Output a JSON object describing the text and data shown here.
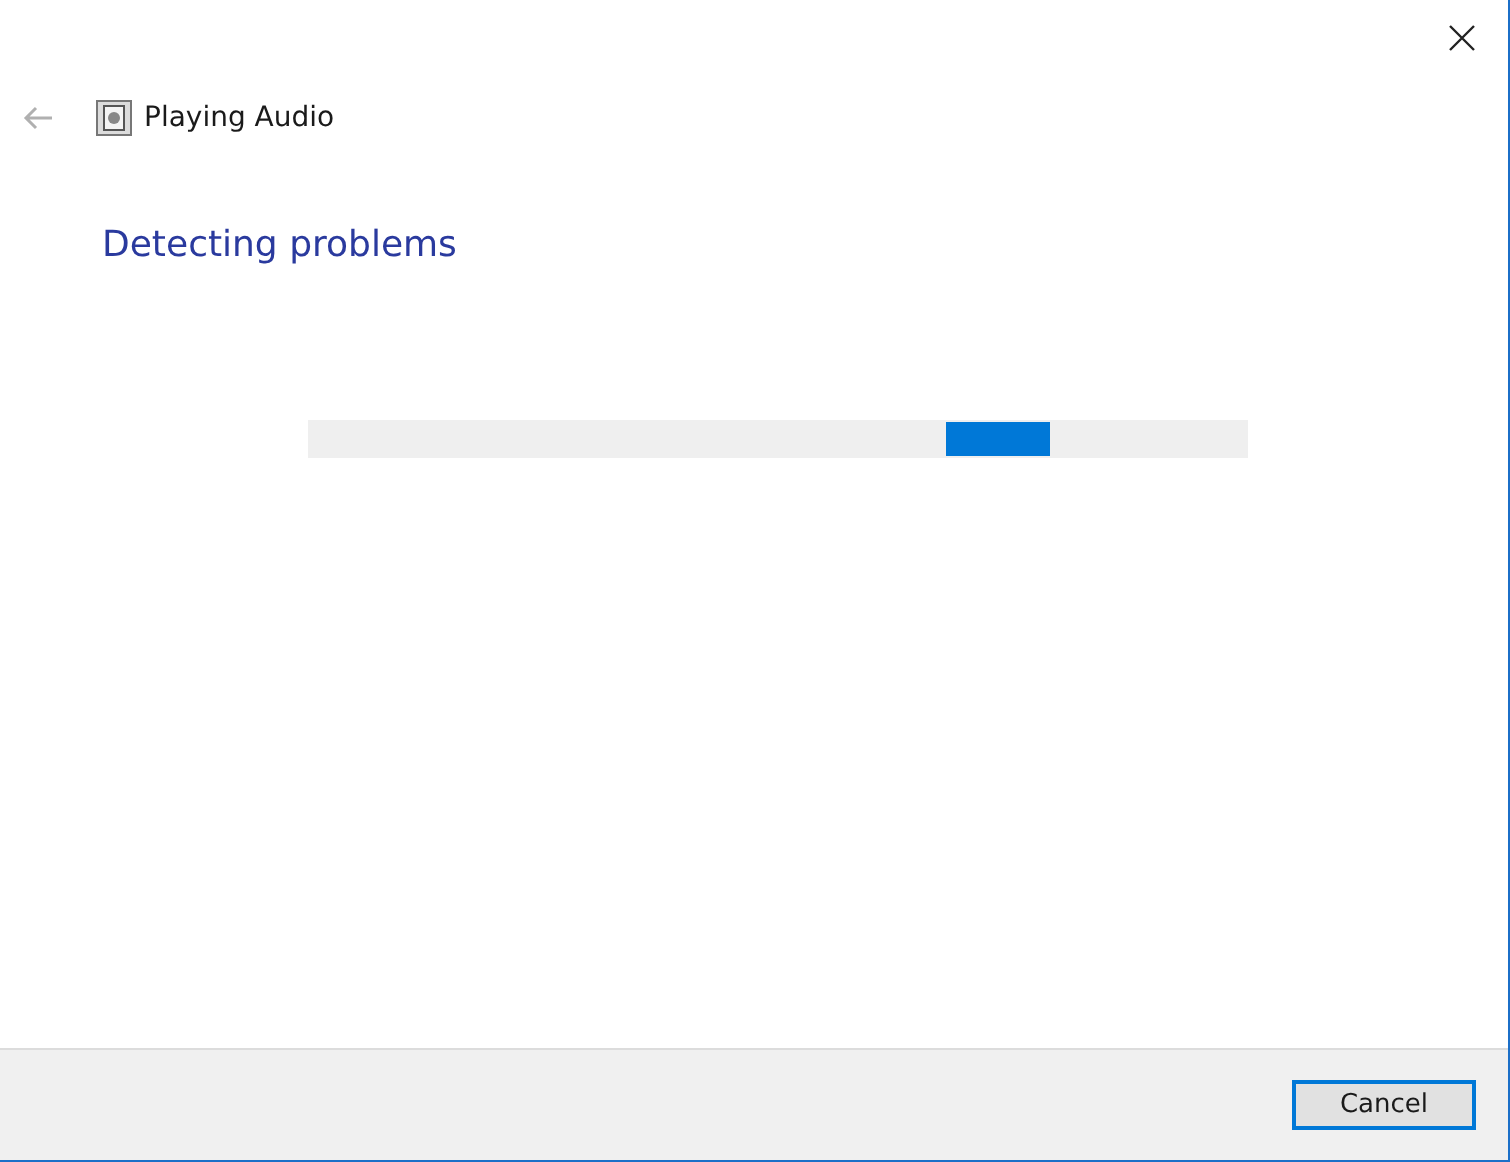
{
  "window": {
    "title": "Playing Audio"
  },
  "heading": "Detecting problems",
  "progress": {
    "kind": "indeterminate"
  },
  "buttons": [
    {
      "label": "Cancel",
      "default": true
    }
  ]
}
